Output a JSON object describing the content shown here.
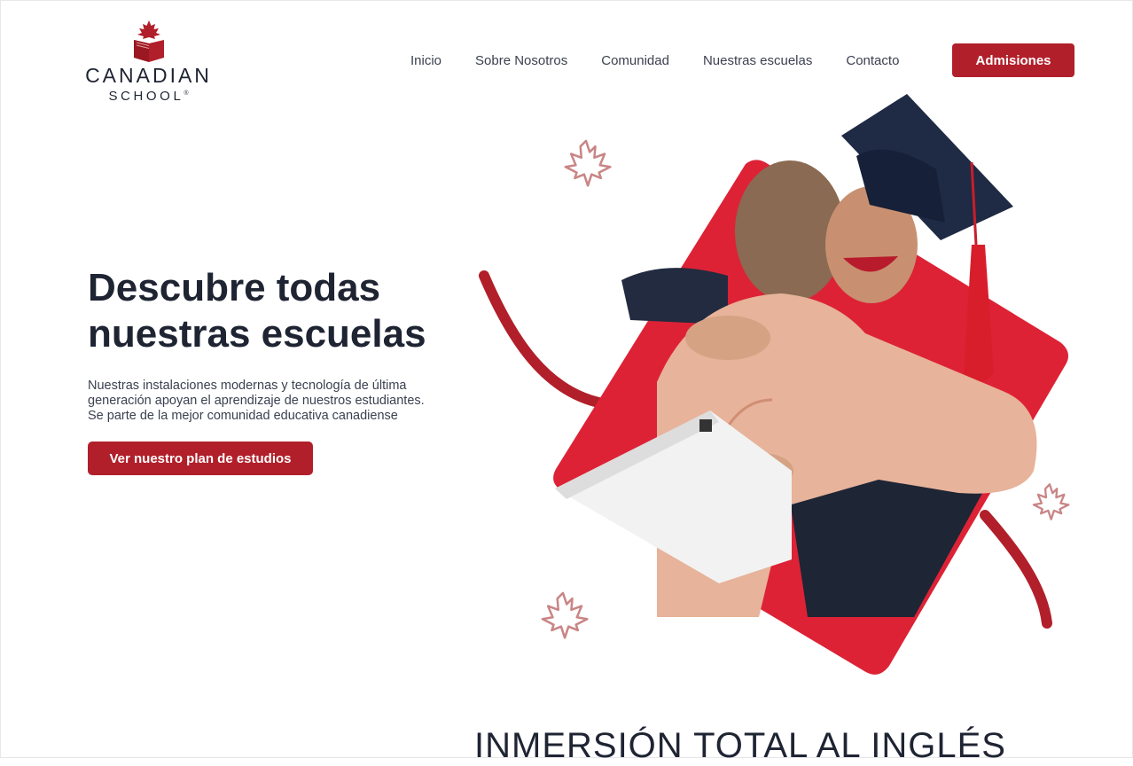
{
  "brand": {
    "name_line1": "CANADIAN",
    "name_line2": "SCHOOL",
    "registered": "®"
  },
  "nav": {
    "items": [
      {
        "label": "Inicio"
      },
      {
        "label": "Sobre Nosotros"
      },
      {
        "label": "Comunidad"
      },
      {
        "label": "Nuestras escuelas"
      },
      {
        "label": "Contacto"
      }
    ],
    "cta_label": "Admisiones"
  },
  "hero": {
    "title_line1": "Descubre todas",
    "title_line2": "nuestras escuelas",
    "description_line1": "Nuestras instalaciones modernas y tecnología de última",
    "description_line2": "generación apoyan el aprendizaje de nuestros estudiantes.",
    "description_line3": "Se parte de la mejor comunidad educativa canadiense",
    "cta_label": "Ver nuestro plan de estudios",
    "image_icon": "graduation-hug-photo"
  },
  "next_section": {
    "title": "INMERSIÓN TOTAL AL INGLÉS"
  },
  "colors": {
    "brand_red": "#b11f2a",
    "accent_red": "#dd2236",
    "text_dark": "#1f2433",
    "leaf_outline": "#c98585"
  }
}
